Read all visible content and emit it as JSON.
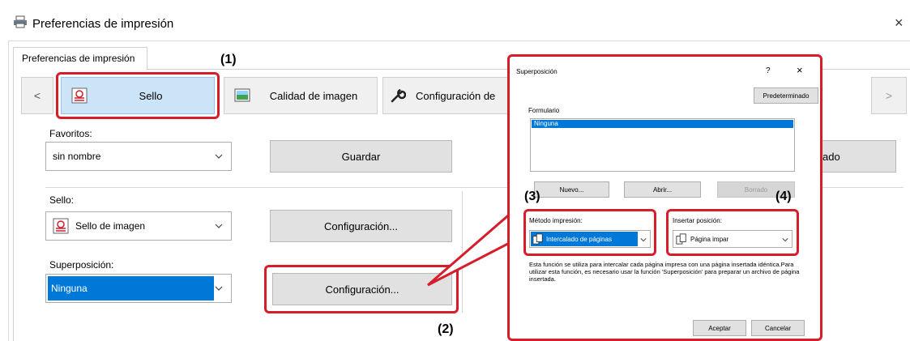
{
  "window": {
    "title": "Preferencias de impresión",
    "close_glyph": "×",
    "tab_label": "Preferencias de impresión"
  },
  "ribbon": {
    "prev_glyph": "<",
    "next_glyph": ">",
    "items": [
      {
        "label": "Sello",
        "icon": "stamp-icon",
        "selected": true
      },
      {
        "label": "Calidad de imagen",
        "icon": "image-quality-icon",
        "selected": false
      },
      {
        "label": "Configuración de",
        "icon": "wrench-icon",
        "selected": false
      }
    ]
  },
  "favorites": {
    "label": "Favoritos:",
    "value": "sin nombre",
    "save_button": "Guardar",
    "partial_button": "ado"
  },
  "stamp": {
    "label": "Sello:",
    "value": "Sello de imagen",
    "config_button": "Configuración..."
  },
  "overlay": {
    "label": "Superposición:",
    "value": "Ninguna",
    "config_button": "Configuración..."
  },
  "callouts": [
    "(1)",
    "(2)",
    "(3)",
    "(4)"
  ],
  "dialog": {
    "title": "Superposición",
    "help_glyph": "?",
    "close_glyph": "×",
    "default_button": "Predeterminado",
    "form_label": "Formulario",
    "form_items": [
      "Ninguna"
    ],
    "new_button": "Nuevo...",
    "open_button": "Abrir...",
    "delete_button": "Borrado",
    "print_method_label": "Método impresión:",
    "print_method_value": "Intercalado de páginas",
    "insert_pos_label": "Insertar posición:",
    "insert_pos_value": "Página impar",
    "description": "Esta función se utiliza para intercalar cada página impresa con una página insertada idéntica.Para utilizar esta función, es necesario usar la función 'Superposición' para preparar un archivo de página insertada.",
    "ok_button": "Aceptar",
    "cancel_button": "Cancelar"
  },
  "colors": {
    "accent_red": "#d61d2a",
    "selection_blue": "#0078d7",
    "ribbon_selected": "#cce4f7"
  }
}
